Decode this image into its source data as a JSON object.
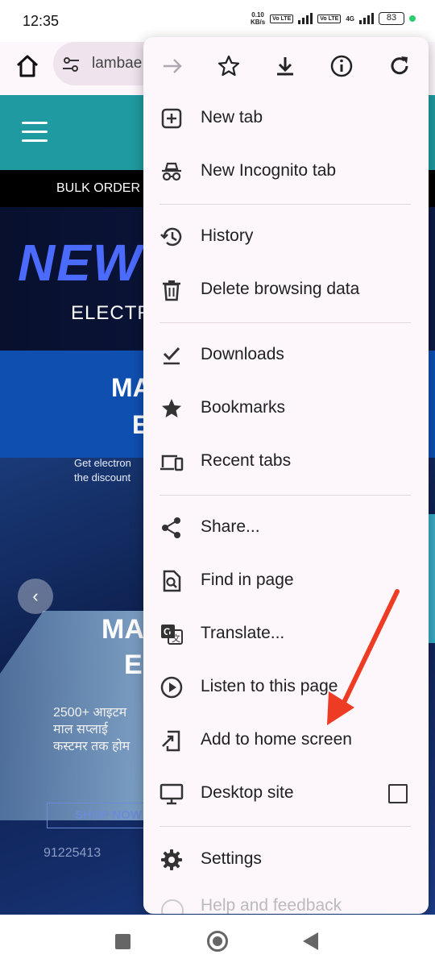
{
  "status_bar": {
    "time": "12:35",
    "net_speed_value": "0.10",
    "net_speed_unit": "KB/s",
    "volte_1": "Vo LTE",
    "volte_2": "Vo LTE",
    "network": "4G",
    "battery": "83"
  },
  "toolbar": {
    "url_text": "lambae",
    "home_icon": "home-icon",
    "site_settings_icon": "tune-icon"
  },
  "page": {
    "bulk_text": "BULK ORDER",
    "headline": "NEW A",
    "subheadline": "ELECTR",
    "band_line_1": "MA",
    "band_line_2": "E",
    "banner_text_1": "Get electron",
    "banner_text_2": "the discount",
    "slide_line_1": "MA",
    "slide_line_2": "E",
    "hindi_1": "2500+ आइटम",
    "hindi_2": "माल सप्लाई",
    "hindi_3": "कस्टमर तक होम",
    "shop_now": "SHOP NOW",
    "phone": "91225413"
  },
  "menu": {
    "top_actions": [
      "forward-icon",
      "bookmark-star-icon",
      "download-icon",
      "info-icon",
      "refresh-icon"
    ],
    "items": [
      {
        "label": "New tab",
        "icon": "new-tab-icon"
      },
      {
        "label": "New Incognito tab",
        "icon": "incognito-icon"
      },
      {
        "label": "History",
        "icon": "history-icon"
      },
      {
        "label": "Delete browsing data",
        "icon": "trash-icon"
      },
      {
        "label": "Downloads",
        "icon": "downloads-check-icon"
      },
      {
        "label": "Bookmarks",
        "icon": "star-icon"
      },
      {
        "label": "Recent tabs",
        "icon": "devices-icon"
      },
      {
        "label": "Share...",
        "icon": "share-icon"
      },
      {
        "label": "Find in page",
        "icon": "find-in-page-icon"
      },
      {
        "label": "Translate...",
        "icon": "translate-icon"
      },
      {
        "label": "Listen to this page",
        "icon": "play-circle-icon"
      },
      {
        "label": "Add to home screen",
        "icon": "add-to-home-icon"
      },
      {
        "label": "Desktop site",
        "icon": "monitor-icon",
        "checked": false
      },
      {
        "label": "Settings",
        "icon": "gear-icon"
      },
      {
        "label": "Help and feedback",
        "icon": "help-icon"
      }
    ]
  },
  "colors": {
    "menu_bg": "#fdf6fb",
    "teal": "#1f9aa0",
    "annotation_red": "#ee3b24"
  }
}
